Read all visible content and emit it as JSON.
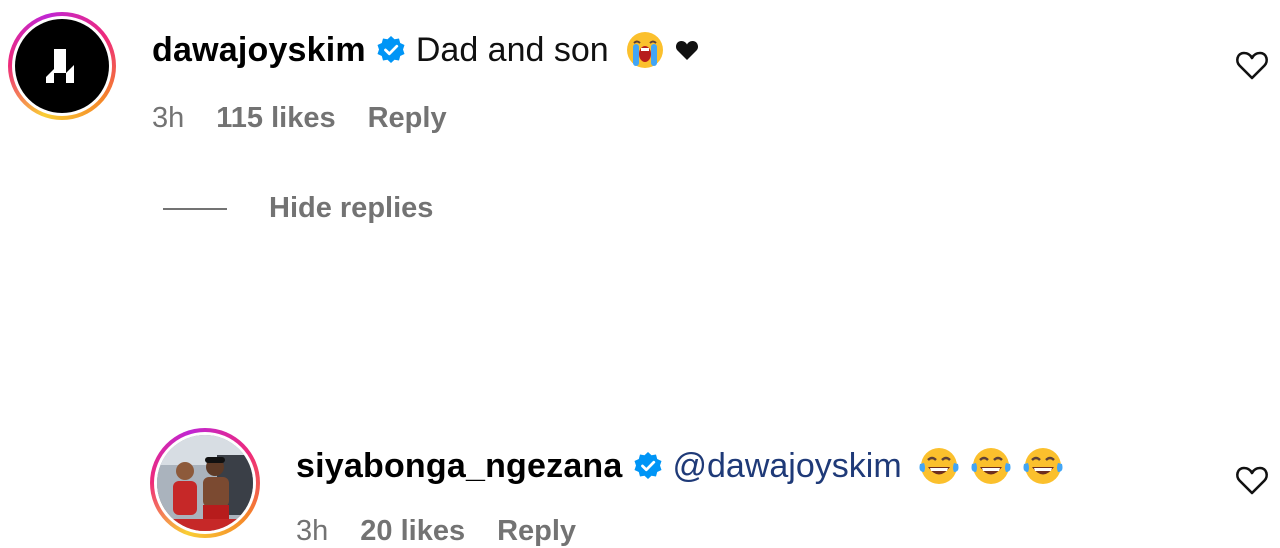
{
  "comments": [
    {
      "username": "dawajoyskim",
      "verified": true,
      "text": "Dad and son",
      "emojis": [
        "loudly-crying-face",
        "black-heart"
      ],
      "time": "3h",
      "likes": "115 likes",
      "reply_label": "Reply"
    },
    {
      "username": "siyabonga_ngezana",
      "verified": true,
      "mention": "@dawajoyskim",
      "emojis": [
        "face-with-tears-of-joy",
        "face-with-tears-of-joy",
        "face-with-tears-of-joy"
      ],
      "time": "3h",
      "likes": "20 likes",
      "reply_label": "Reply"
    }
  ],
  "replies_toggle": {
    "label": "Hide replies"
  },
  "colors": {
    "verified_blue": "#0095f6",
    "meta_gray": "#737373",
    "mention_blue": "#1f3a78"
  }
}
